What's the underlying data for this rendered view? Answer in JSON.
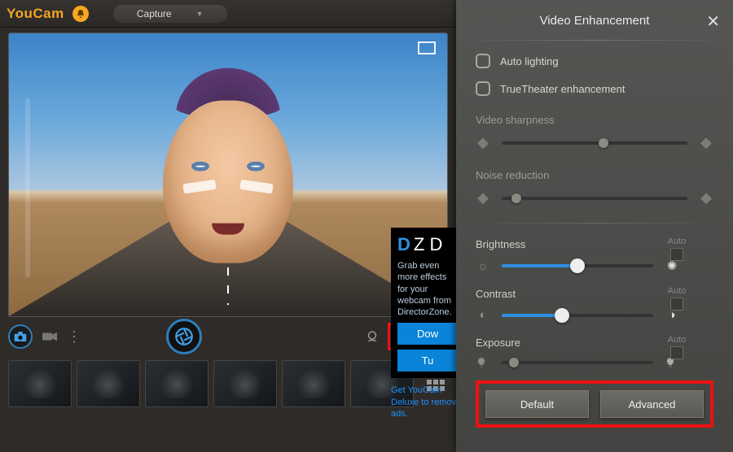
{
  "header": {
    "app_name": "YouCam",
    "mode": "Capture"
  },
  "toolbar": {
    "camera": "camera",
    "video": "video",
    "shutter": "shutter",
    "face": "face-beauty",
    "enhance": "eye-enhance",
    "eraser": "eraser"
  },
  "ad": {
    "brand_prefix": "D",
    "brand_rest": "Z D",
    "text": "Grab even more effects for your webcam from DirectorZone.",
    "btn1": "Dow",
    "btn2": "Tu",
    "link": "Get YouCam Deluxe to remove ads."
  },
  "panel": {
    "title": "Video Enhancement",
    "auto_lighting": "Auto lighting",
    "truetheater": "TrueTheater enhancement",
    "sharpness_label": "Video sharpness",
    "noise_label": "Noise reduction",
    "brightness_label": "Brightness",
    "contrast_label": "Contrast",
    "exposure_label": "Exposure",
    "auto_label": "Auto",
    "default_btn": "Default",
    "advanced_btn": "Advanced"
  },
  "sliders": {
    "sharpness": 55,
    "noise": 8,
    "brightness": 50,
    "contrast": 40,
    "exposure": 8
  }
}
